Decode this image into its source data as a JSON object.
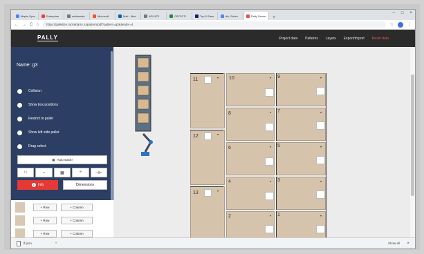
{
  "browser": {
    "tabs": [
      {
        "label": "Maple Sync",
        "color": "#4a8af4"
      },
      {
        "label": "Enterprise",
        "color": "#ea4335"
      },
      {
        "label": "solidworks",
        "color": "#777777"
      },
      {
        "label": "Microsoft",
        "color": "#f25022"
      },
      {
        "label": "Mail - Mari",
        "color": "#0a64ad"
      },
      {
        "label": "API1872",
        "color": "#777777"
      },
      {
        "label": "CRITICTI",
        "color": "#1e8e3e"
      },
      {
        "label": "Top 5 Stars",
        "color": "#1a1a6b"
      },
      {
        "label": "div: Subm",
        "color": "#4a8af4"
      },
      {
        "label": "Pally Server",
        "color": "#e3564d"
      }
    ],
    "new_tab": "+",
    "window_controls": [
      "–",
      "□",
      "×"
    ],
    "nav_glyphs": [
      "←",
      "→",
      "C",
      "⌂"
    ],
    "url": "https://palletize.rockettarm.ru/pattern/pdf?pattern=g3&tender=4",
    "star_glyph": "☆",
    "menu_glyph": "⋮"
  },
  "app": {
    "logo": "PALLY",
    "menu": [
      "Project data",
      "Patterns",
      "Layers",
      "Export/Import"
    ],
    "menu_danger": "Reset data"
  },
  "sidebar": {
    "name_label": "Name:  g3",
    "toggles": [
      "Collision",
      "Show box positions",
      "Restrict to pallet",
      "Show left side pallet",
      "Drag select"
    ],
    "auto_stack": "Auto stack!",
    "tool_icons": [
      "↑↓",
      "↔",
      "▦",
      "÷",
      "⊣⊢"
    ],
    "info": "Info",
    "info_glyph": "i",
    "dimensions": "Dimensions",
    "rows": [
      {
        "row": "+ Row",
        "column": "+ Column"
      },
      {
        "row": "+ Row",
        "column": "+ Column"
      },
      {
        "row": "+ Row",
        "column": "+ Column"
      }
    ]
  },
  "canvas": {
    "left_boxes": [
      "11",
      "12",
      "13"
    ],
    "mid_boxes": [
      "10",
      "8",
      "6",
      "4",
      "2"
    ],
    "right_boxes": [
      "9",
      "7",
      "5",
      "3",
      "1"
    ],
    "arrow": "▾"
  },
  "downloads": {
    "file": "ff.json",
    "caret": "^",
    "show_all": "Show all",
    "close": "×"
  }
}
